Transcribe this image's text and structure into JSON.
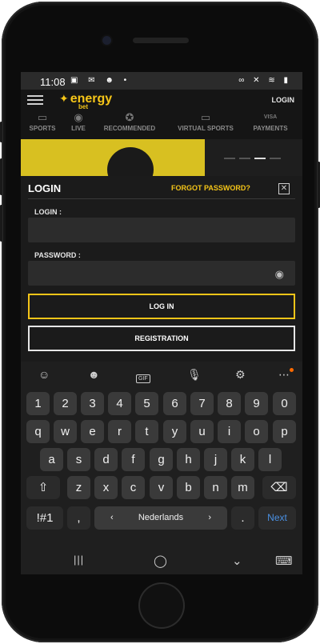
{
  "status_bar": {
    "time": "11:08",
    "left_icons": "▣ ✉ ☻ •",
    "right_icons": "∞ ✕ ≋ ▮"
  },
  "app": {
    "brand": "energy",
    "brand_sub": "bet",
    "login_link": "LOGIN",
    "nav": [
      {
        "label": "SPORTS",
        "icon": "sports-icon",
        "glyph": "▭"
      },
      {
        "label": "LIVE",
        "icon": "live-icon",
        "glyph": "◉"
      },
      {
        "label": "RECOMMENDED",
        "icon": "recommended-icon",
        "glyph": "✪"
      },
      {
        "label": "VIRTUAL SPORTS",
        "icon": "virtual-sports-icon",
        "glyph": "▭"
      },
      {
        "label": "PAYMENTS",
        "icon": "payments-icon",
        "glyph": "VISA"
      }
    ]
  },
  "login_panel": {
    "title": "LOGIN",
    "forgot": "FORGOT PASSWORD?",
    "login_label": "LOGIN :",
    "login_value": "",
    "password_label": "PASSWORD :",
    "password_value": "",
    "login_button": "LOG IN",
    "registration_button": "REGISTRATION"
  },
  "keyboard": {
    "toolbar": [
      "☺",
      "☻",
      "GIF",
      "🎙",
      "⚙",
      "⋯"
    ],
    "row1": [
      "1",
      "2",
      "3",
      "4",
      "5",
      "6",
      "7",
      "8",
      "9",
      "0"
    ],
    "row2": [
      "q",
      "w",
      "e",
      "r",
      "t",
      "y",
      "u",
      "i",
      "o",
      "p"
    ],
    "row3": [
      "a",
      "s",
      "d",
      "f",
      "g",
      "h",
      "j",
      "k",
      "l"
    ],
    "row4": [
      "z",
      "x",
      "c",
      "v",
      "b",
      "n",
      "m"
    ],
    "shift": "⇧",
    "backspace": "⌫",
    "symbols": "!#1",
    "comma": ",",
    "space_label": "Nederlands",
    "space_left": "‹",
    "space_right": "›",
    "period": ".",
    "next": "Next"
  },
  "system_nav": {
    "recents": "|||",
    "home": "◯",
    "back": "⌄",
    "keyboard": "⌨"
  }
}
